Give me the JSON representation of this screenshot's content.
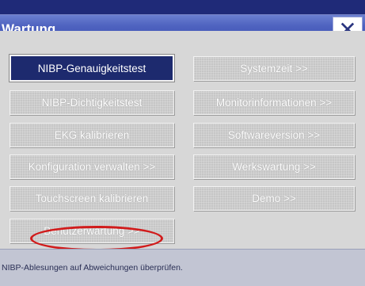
{
  "window": {
    "title": "Wartung",
    "close_glyph": "✕"
  },
  "buttons": {
    "nibp_accuracy": "NIBP-Genauigkeitstest",
    "nibp_leak": "NIBP-Dichtigkeitstest",
    "ecg_calibrate": "EKG kalibrieren",
    "config_manage": "Konfiguration verwalten >>",
    "touch_calibrate": "Touchscreen kalibrieren",
    "user_maintenance": "Benutzerwartung >>",
    "system_time": "Systemzeit >>",
    "monitor_info": "Monitorinformationen >>",
    "software_version": "Softwareversion >>",
    "factory_maintenance": "Werkswartung >>",
    "demo": "Demo >>"
  },
  "status": {
    "hint": "NIBP-Ablesungen auf Abweichungen überprüfen."
  },
  "colors": {
    "title_bar": "#4f63c0",
    "active_button": "#1d2a6e",
    "highlight": "#d11b1b"
  }
}
